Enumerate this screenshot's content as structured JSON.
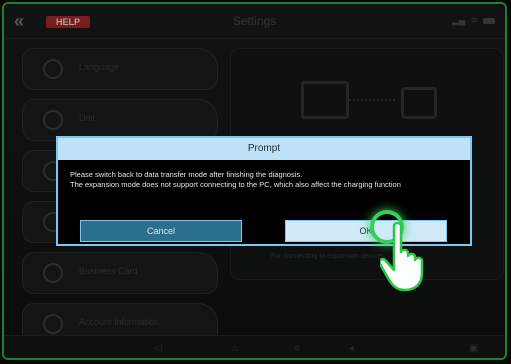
{
  "header": {
    "back_glyph": "«",
    "logo_text": "HELP",
    "title": "Settings"
  },
  "sidebar": {
    "items": [
      {
        "label": "Language",
        "icon": "globe-icon"
      },
      {
        "label": "Unit",
        "icon": "gauge-icon"
      },
      {
        "label": "",
        "icon": "hidden-icon"
      },
      {
        "label": "",
        "icon": "hidden-icon"
      },
      {
        "label": "Business Card",
        "icon": "card-icon"
      },
      {
        "label": "Account Information",
        "icon": "user-icon"
      }
    ]
  },
  "right_panel": {
    "hint_text": "For connecting to expansion devices"
  },
  "dialog": {
    "title": "Prompt",
    "line1": "Please switch back to data transfer mode after finishing the diagnosis.",
    "line2": "The expansion mode does not support connecting to the PC, which also affect the charging function",
    "cancel_label": "Cancel",
    "ok_label": "OK"
  },
  "colors": {
    "accent_green": "#2bc64a",
    "dialog_border": "#7fc6f0",
    "dialog_header": "#bfe3f6",
    "cancel_bg": "#2b6f8e"
  }
}
